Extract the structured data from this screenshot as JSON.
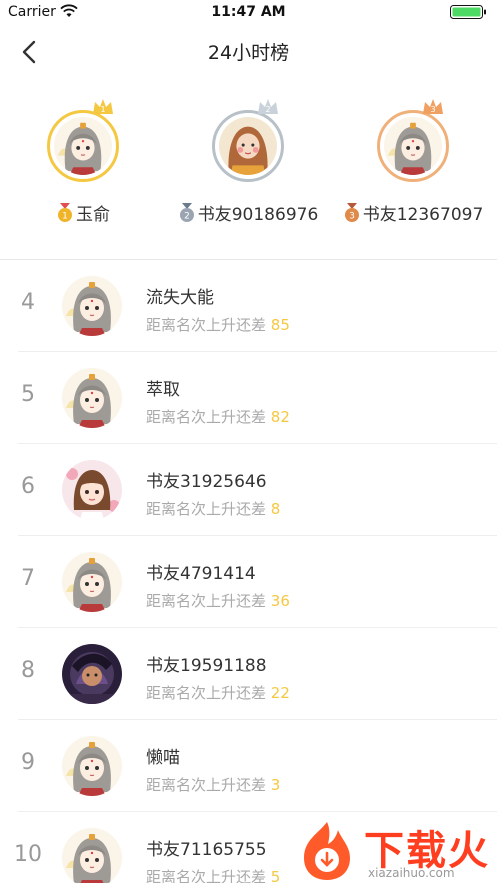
{
  "status": {
    "carrier": "Carrier",
    "time": "11:47 AM"
  },
  "nav": {
    "title": "24小时榜"
  },
  "podium": [
    {
      "rank": "1",
      "name": "玉俞",
      "ring": "#f5c842",
      "medal": "#f0b429"
    },
    {
      "rank": "2",
      "name": "书友90186976",
      "ring": "#b8c0c8",
      "medal": "#9aa5b1"
    },
    {
      "rank": "3",
      "name": "书友12367097",
      "ring": "#f0b07a",
      "medal": "#e08a4a"
    }
  ],
  "list_label": "距离名次上升还差",
  "list": [
    {
      "rank": "4",
      "name": "流失大能",
      "diff": "85",
      "avatar": "girl-gray"
    },
    {
      "rank": "5",
      "name": "萃取",
      "diff": "82",
      "avatar": "girl-gray"
    },
    {
      "rank": "6",
      "name": "书友31925646",
      "diff": "8",
      "avatar": "girl-brown"
    },
    {
      "rank": "7",
      "name": "书友4791414",
      "diff": "36",
      "avatar": "girl-gray"
    },
    {
      "rank": "8",
      "name": "书友19591188",
      "diff": "22",
      "avatar": "dark-art"
    },
    {
      "rank": "9",
      "name": "懒喵",
      "diff": "3",
      "avatar": "girl-gray"
    },
    {
      "rank": "10",
      "name": "书友71165755",
      "diff": "5",
      "avatar": "girl-gray"
    }
  ],
  "watermark": {
    "text": "下载火",
    "url": "xiazaihuo.com"
  }
}
